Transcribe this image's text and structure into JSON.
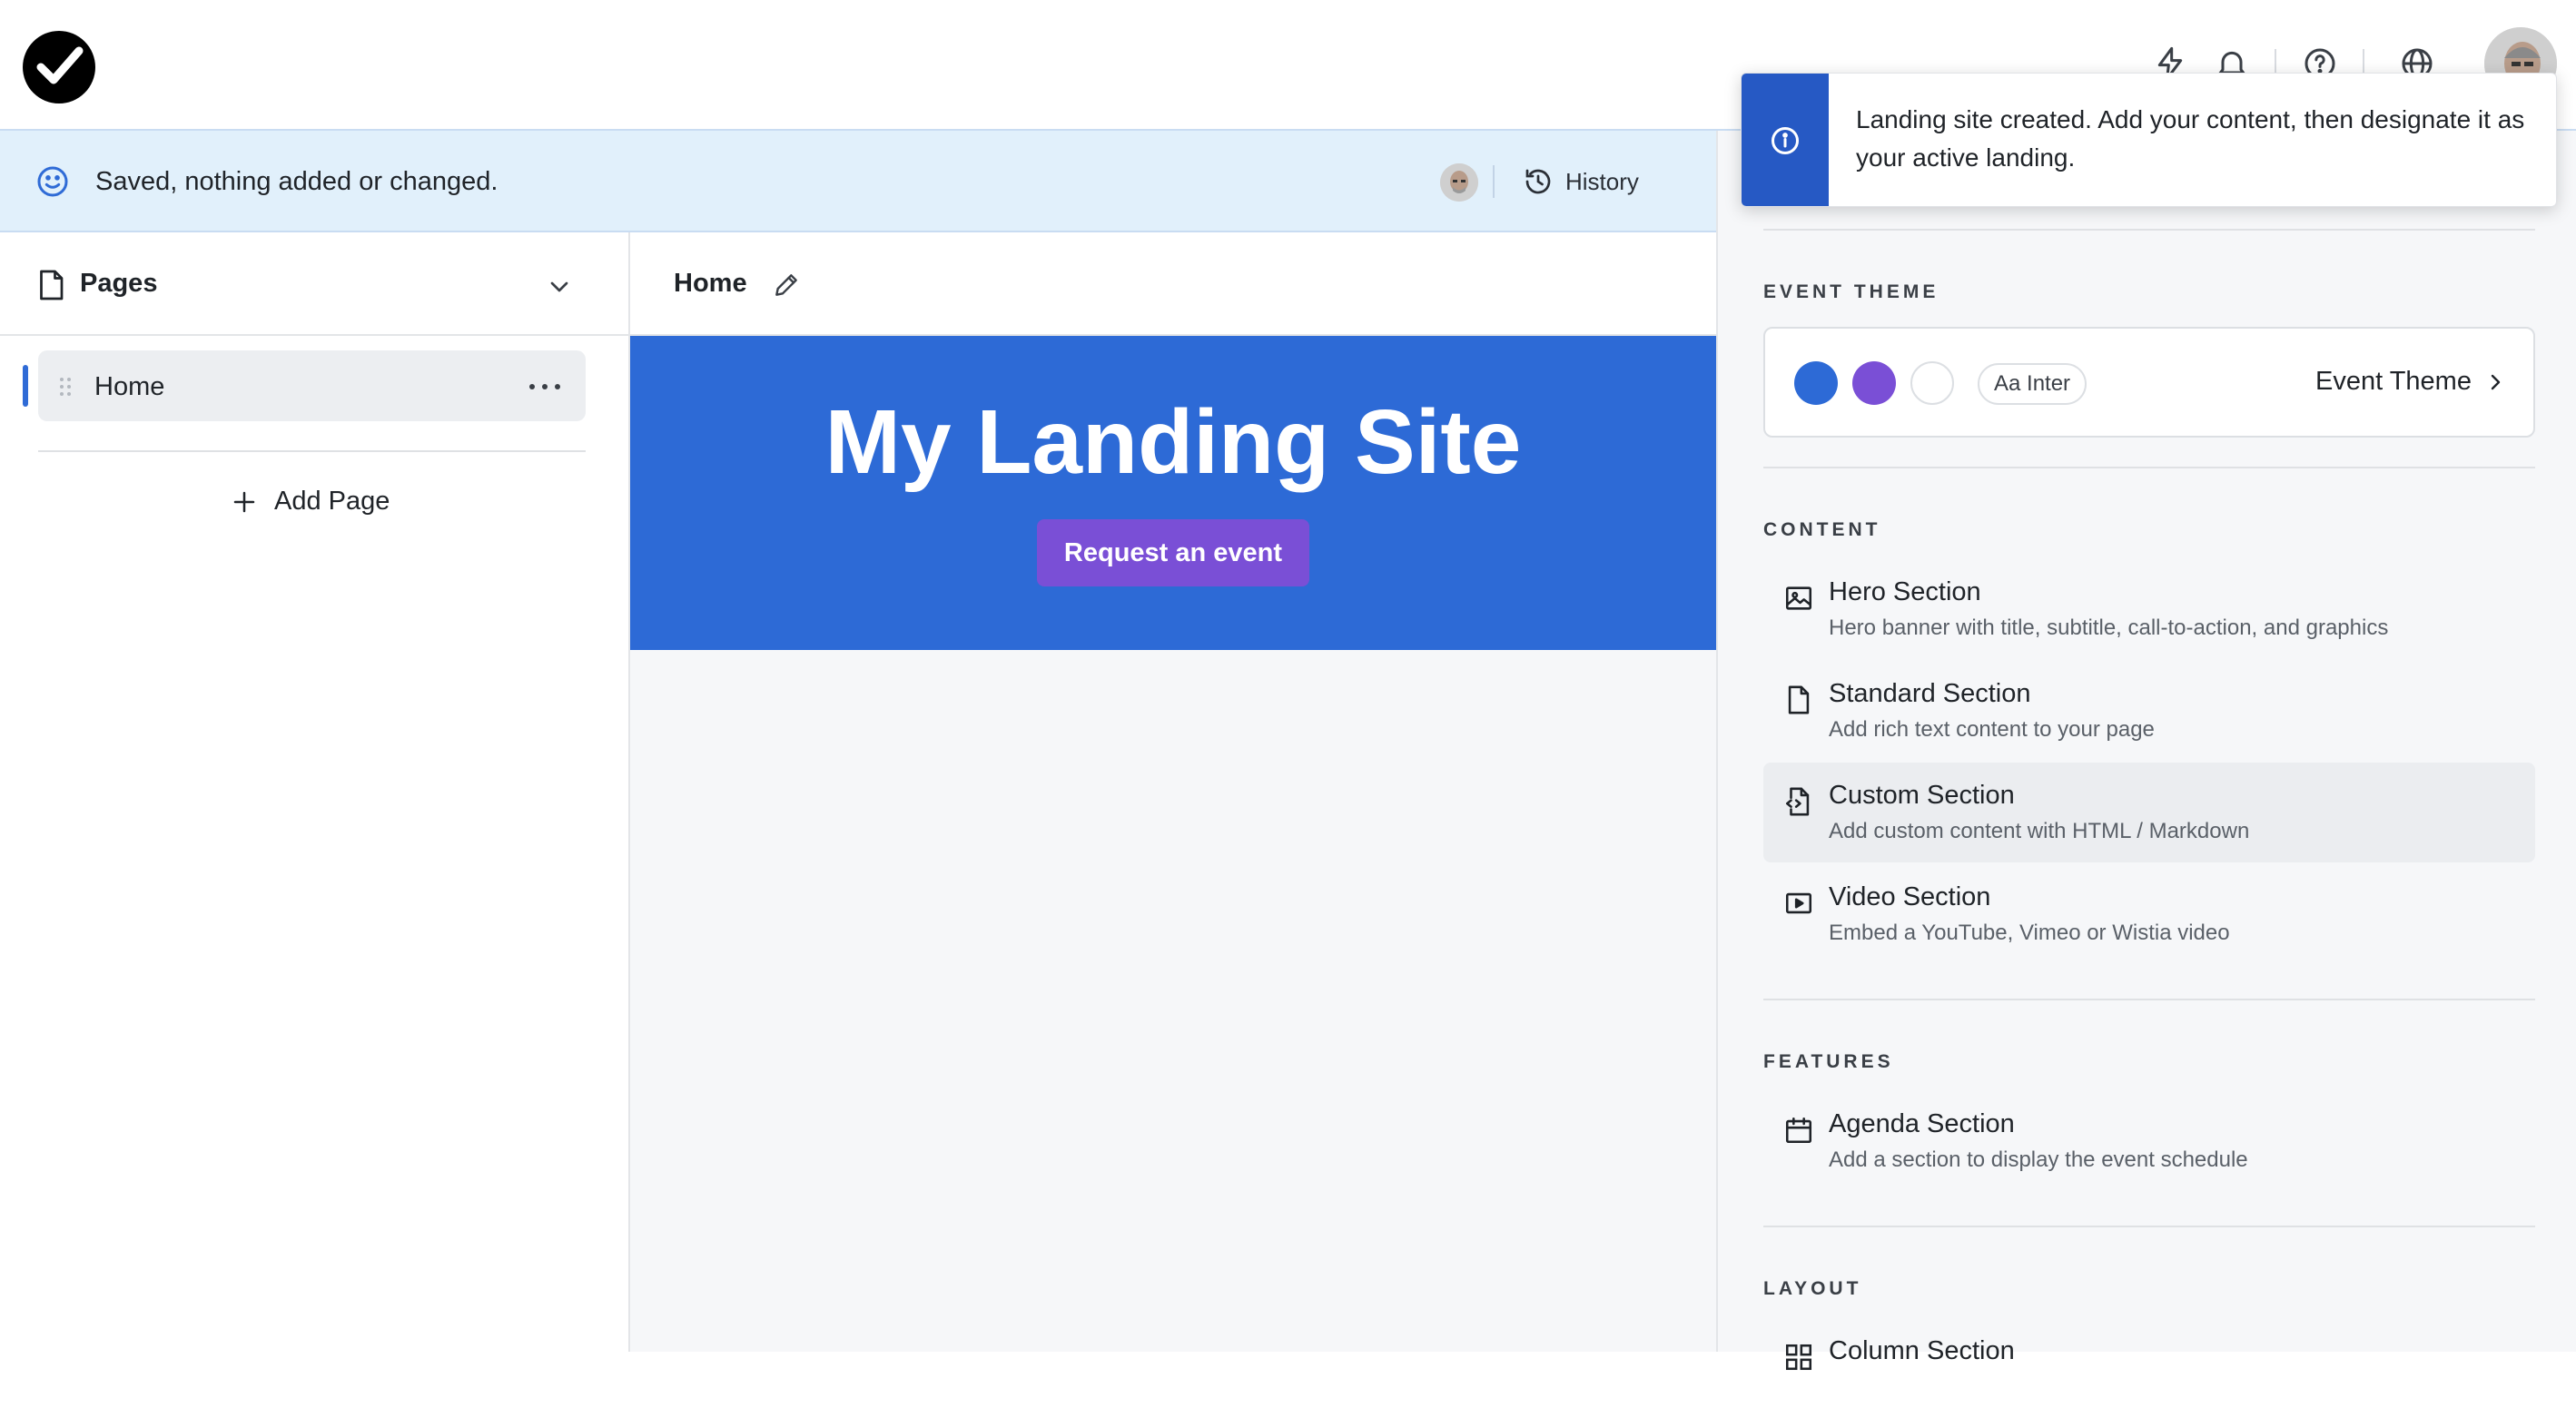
{
  "header": {
    "logo": "checkmark-logo",
    "icons": [
      "bolt-icon",
      "bell-icon",
      "help-icon",
      "globe-icon"
    ],
    "accent": "#000000"
  },
  "savebar": {
    "status": "Saved, nothing added or changed.",
    "history_label": "History",
    "background": "#e1f0fb"
  },
  "pages_panel": {
    "title": "Pages",
    "pages": [
      {
        "label": "Home",
        "active": true
      }
    ],
    "add_label": "Add Page"
  },
  "preview": {
    "page_title": "Home",
    "hero": {
      "title": "My Landing Site",
      "button_label": "Request an event",
      "background": "#2d6ad6",
      "button_color": "#7a4fd6"
    }
  },
  "side_panel": {
    "event_theme": {
      "heading": "EVENT THEME",
      "swatches": [
        "#2d6ad6",
        "#7a4fd6",
        "#ffffff"
      ],
      "font_chip": "Aa Inter",
      "link_label": "Event Theme"
    },
    "content": {
      "heading": "CONTENT",
      "items": [
        {
          "title": "Hero Section",
          "desc": "Hero banner with title, subtitle, call-to-action, and graphics",
          "icon": "image-icon"
        },
        {
          "title": "Standard Section",
          "desc": "Add rich text content to your page",
          "icon": "document-icon"
        },
        {
          "title": "Custom Section",
          "desc": "Add custom content with HTML / Markdown",
          "icon": "code-file-icon"
        },
        {
          "title": "Video Section",
          "desc": "Embed a YouTube, Vimeo or Wistia video",
          "icon": "video-icon"
        }
      ]
    },
    "features": {
      "heading": "FEATURES",
      "items": [
        {
          "title": "Agenda Section",
          "desc": "Add a section to display the event schedule",
          "icon": "calendar-icon"
        }
      ]
    },
    "layout": {
      "heading": "LAYOUT",
      "items": [
        {
          "title": "Column Section",
          "icon": "columns-icon"
        }
      ]
    }
  },
  "toast": {
    "message": "Landing site created. Add your content, then designate it as your active landing.",
    "accent": "#2659c4"
  }
}
